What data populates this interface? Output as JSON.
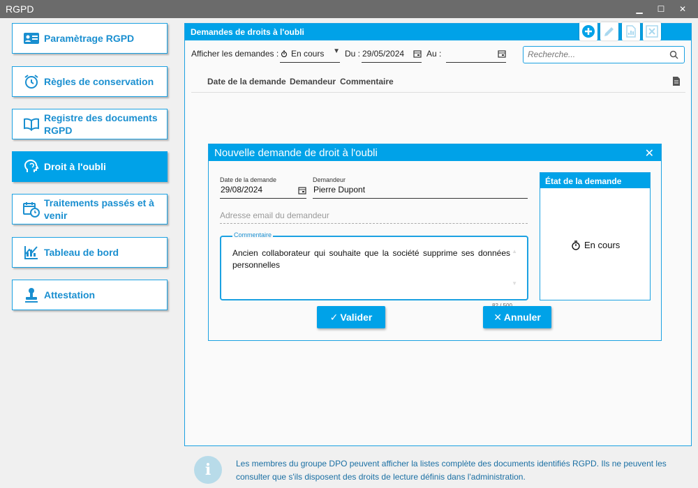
{
  "app": {
    "title": "RGPD"
  },
  "window_controls": {
    "minimize": "▁",
    "maximize": "☐",
    "close": "✕"
  },
  "sidebar": {
    "items": [
      {
        "label": "Paramètrage RGPD",
        "icon": "id-card-icon",
        "active": false
      },
      {
        "label": "Règles de conservation",
        "icon": "alarm-clock-icon",
        "active": false
      },
      {
        "label": "Registre des documents RGPD",
        "icon": "open-book-icon",
        "active": false
      },
      {
        "label": "Droit à l'oubli",
        "icon": "head-icon",
        "active": true
      },
      {
        "label": "Traitements passés et à venir",
        "icon": "calendar-clock-icon",
        "active": false
      },
      {
        "label": "Tableau de bord",
        "icon": "chart-icon",
        "active": false
      },
      {
        "label": "Attestation",
        "icon": "stamp-icon",
        "active": false
      }
    ]
  },
  "panel": {
    "title": "Demandes de droits à l'oubli",
    "toolbar": [
      "add-icon",
      "edit-icon",
      "report-icon",
      "delete-icon"
    ],
    "filter": {
      "label": "Afficher les demandes :",
      "status_value": "En cours",
      "from_label": "Du :",
      "from_value": "29/05/2024",
      "to_label": "Au :",
      "to_value": ""
    },
    "search": {
      "placeholder": "Recherche..."
    },
    "columns": [
      "Date de la demande",
      "Demandeur",
      "Commentaire"
    ]
  },
  "dialog": {
    "title": "Nouvelle demande de droit à l'oubli",
    "date_label": "Date de la demande",
    "date_value": "29/08/2024",
    "requester_label": "Demandeur",
    "requester_value": "Pierre Dupont",
    "email_placeholder": "Adresse email du demandeur",
    "comment_label": "Commentaire",
    "comment_value": "Ancien collaborateur qui souhaite que la société supprime ses données personnelles",
    "counter": "82 / 500",
    "state_title": "État de la demande",
    "state_value": "En cours",
    "validate_label": "Valider",
    "cancel_label": "Annuler"
  },
  "info": {
    "icon_glyph": "i",
    "message": "Les membres du groupe DPO peuvent afficher la listes complète des documents identifiés RGPD. Ils ne peuvent les consulter que s'ils disposent des droits de lecture définis dans l'administration."
  },
  "colors": {
    "accent": "#00a2e8",
    "border": "#1ba1e2",
    "titlebar": "#6b6b6b"
  }
}
